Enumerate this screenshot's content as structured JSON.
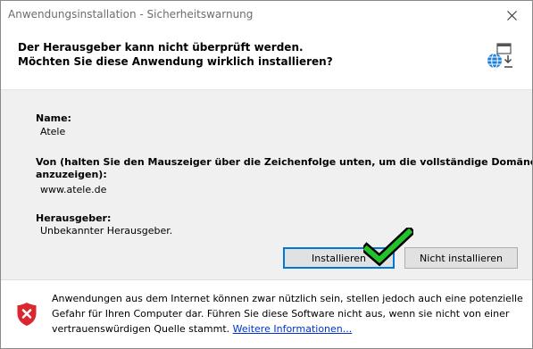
{
  "window": {
    "title": "Anwendungsinstallation - Sicherheitswarnung",
    "close_symbol": "✕"
  },
  "header": {
    "line1": "Der Herausgeber kann nicht überprüft werden.",
    "line2": "Möchten Sie diese Anwendung wirklich installieren?",
    "icon": "web-install-icon"
  },
  "details": {
    "name_label": "Name:",
    "name_value": "Atele",
    "from_label_line1": "Von (halten Sie den Mauszeiger über die Zeichenfolge unten, um die vollständige Domäne",
    "from_label_line2": "anzuzeigen):",
    "from_value": "www.atele.de",
    "publisher_label": "Herausgeber:",
    "publisher_value": "Unbekannter Herausgeber."
  },
  "buttons": {
    "install": "Installieren",
    "dont_install": "Nicht installieren"
  },
  "footer": {
    "line1": "Anwendungen aus dem Internet können zwar nützlich sein, stellen jedoch auch eine potenzielle",
    "line2": "Gefahr für Ihren Computer dar. Führen Sie diese Software nicht aus, wenn sie nicht von einer",
    "line3_prefix": "vertrauenswürdigen Quelle stammt. ",
    "more_info_link": "Weitere Informationen..."
  },
  "colors": {
    "accent_blue": "#0078d7",
    "check_green": "#22c22a",
    "shield_red": "#d9262f",
    "link_blue": "#0033cc"
  },
  "icons": [
    "close-icon",
    "web-install-icon",
    "checkmark-icon",
    "shield-warning-icon"
  ]
}
